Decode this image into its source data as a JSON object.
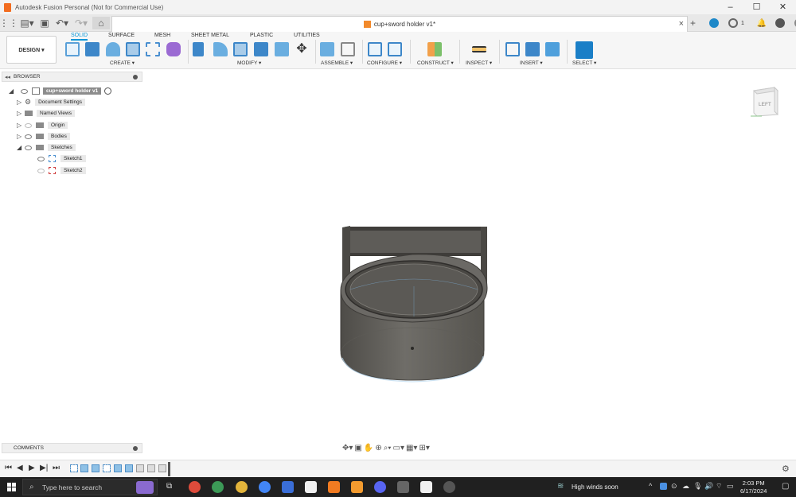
{
  "window": {
    "title": "Autodesk Fusion Personal (Not for Commercial Use)",
    "controls": [
      "minimize-icon",
      "maximize-icon",
      "close-icon"
    ]
  },
  "document_tab": {
    "name": "cup+sword holder v1*",
    "close_icon": "close-icon",
    "job_count": "1"
  },
  "toolbar": {
    "workspace": "DESIGN ▾",
    "tabs": [
      "SOLID",
      "SURFACE",
      "MESH",
      "SHEET METAL",
      "PLASTIC",
      "UTILITIES"
    ],
    "active_tab": "SOLID",
    "groups": [
      "CREATE ▾",
      "MODIFY ▾",
      "ASSEMBLE ▾",
      "CONFIGURE ▾",
      "CONSTRUCT ▾",
      "INSPECT ▾",
      "INSERT ▾",
      "SELECT ▾"
    ]
  },
  "browser": {
    "title": "BROWSER",
    "root": "cup+sword holder v1",
    "items": [
      "Document Settings",
      "Named Views",
      "Origin",
      "Bodies",
      "Sketches"
    ],
    "sketches": [
      "Sketch1",
      "Sketch2"
    ]
  },
  "viewcube": {
    "face": "LEFT"
  },
  "comments": {
    "title": "COMMENTS"
  },
  "taskbar": {
    "search_placeholder": "Type here to search",
    "weather": "High winds soon",
    "time": "2:03 PM",
    "date": "6/17/2024"
  },
  "colors": {
    "accent": "#0696d7",
    "body": "#5c5a55",
    "body_top": "#7a7872",
    "taskbar": "#202020"
  }
}
